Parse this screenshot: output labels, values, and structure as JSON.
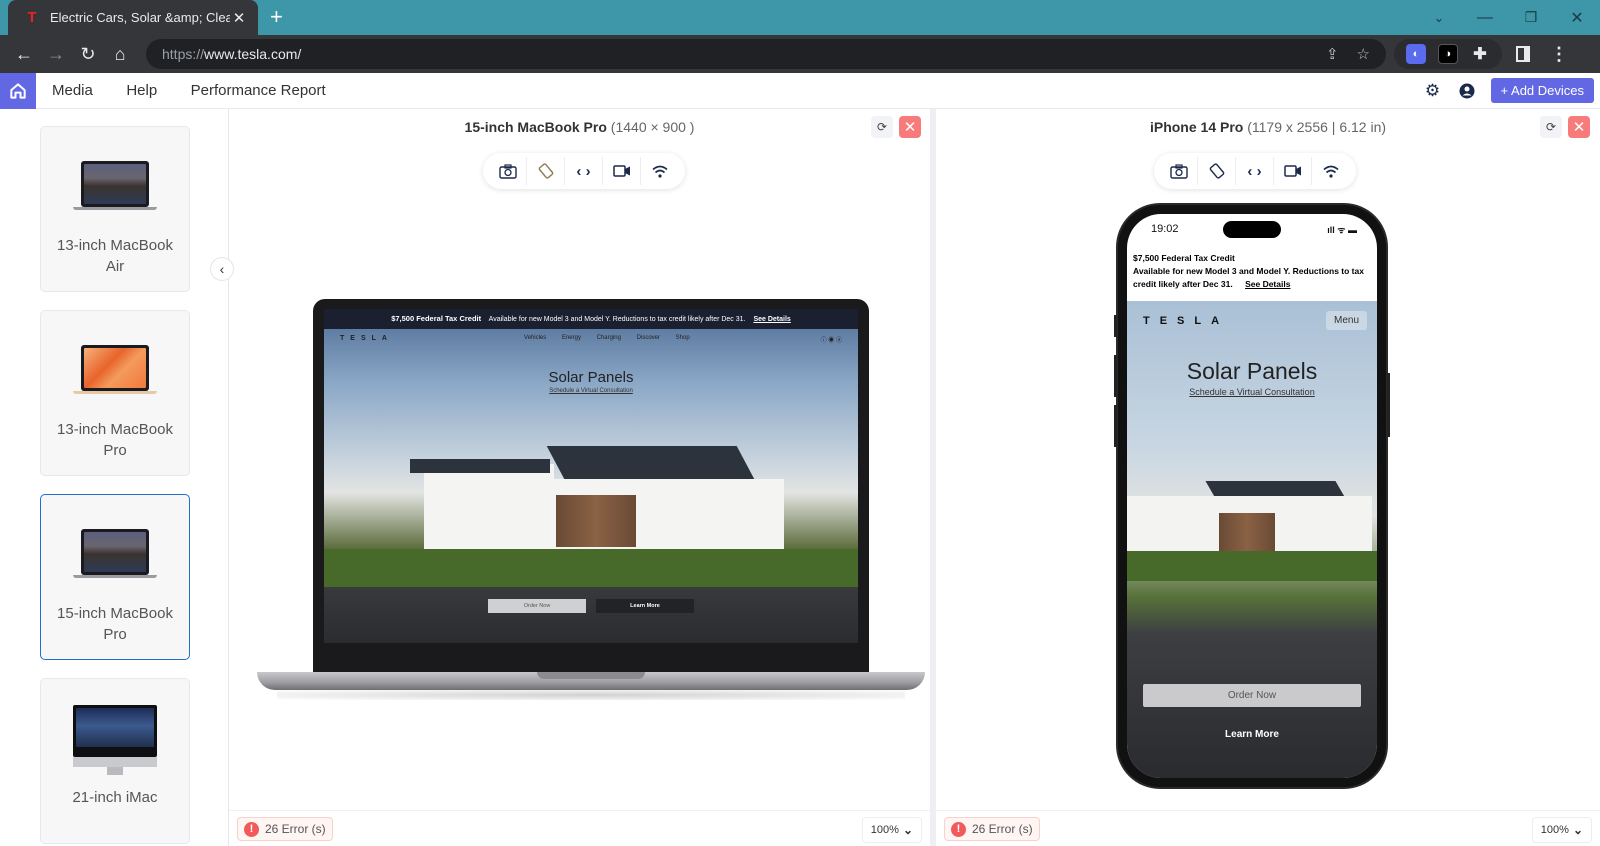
{
  "browser": {
    "tab_title": "Electric Cars, Solar &amp; Clean E",
    "favicon": "T",
    "new_tab": "+",
    "url_scheme": "https://",
    "url_host": "www.tesla.com/",
    "window_controls": [
      "⌄",
      "—",
      "❐",
      "✕"
    ]
  },
  "app": {
    "nav": [
      "Media",
      "Help",
      "Performance Report"
    ],
    "add_devices_label": "+ Add Devices"
  },
  "sidebar": {
    "devices": [
      {
        "label": "13-inch MacBook Air",
        "selected": false
      },
      {
        "label": "13-inch MacBook Pro",
        "selected": false
      },
      {
        "label": "15-inch MacBook Pro",
        "selected": true
      },
      {
        "label": "21-inch iMac",
        "selected": false
      }
    ]
  },
  "panels": [
    {
      "device_name": "15-inch MacBook Pro",
      "dims": "(1440 × 900 )",
      "errors": "26 Error (s)",
      "zoom": "100%"
    },
    {
      "device_name": "iPhone 14 Pro",
      "dims": "(1179 x 2556 | 6.12 in)",
      "errors": "26 Error (s)",
      "zoom": "100%"
    }
  ],
  "site": {
    "banner_title": "$7,500 Federal Tax Credit",
    "banner_text_desktop": "Available for new Model 3 and Model Y. Reductions to tax credit likely after Dec 31.",
    "banner_text_mobile": "Available for new Model 3 and Model Y. Reductions to tax credit likely after Dec 31.",
    "banner_link": "See Details",
    "logo": "TESLA",
    "nav_links": [
      "Vehicles",
      "Energy",
      "Charging",
      "Discover",
      "Shop"
    ],
    "menu": "Menu",
    "hero_title": "Solar Panels",
    "hero_subtitle": "Schedule a Virtual Consultation",
    "order_now": "Order Now",
    "learn_more": "Learn More",
    "phone_time": "19:02"
  }
}
